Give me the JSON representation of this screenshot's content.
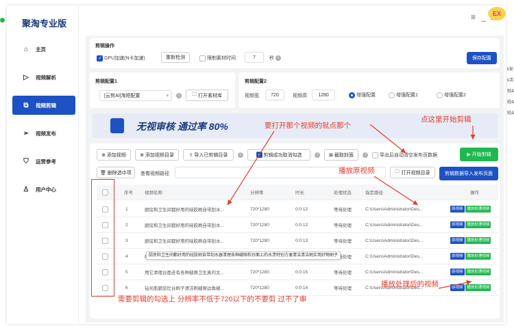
{
  "brand": "聚淘专业版",
  "window": {
    "badge": "EX"
  },
  "nav": [
    {
      "label": "主页",
      "icon": "home-icon",
      "active": false
    },
    {
      "label": "视频解析",
      "icon": "play-icon",
      "active": false
    },
    {
      "label": "视频剪辑",
      "icon": "edit-icon",
      "active": true
    },
    {
      "label": "视频发布",
      "icon": "send-icon",
      "active": false
    },
    {
      "label": "运营参考",
      "icon": "shield-icon",
      "active": false
    },
    {
      "label": "用户中心",
      "icon": "user-icon",
      "active": false
    }
  ],
  "ops": {
    "title": "剪辑操作",
    "gpu_label": "GPU加速(N卡加速)",
    "recheck": "重新检测",
    "limit_label": "限制素材时间",
    "limit_value": "7",
    "limit_unit": "秒",
    "save_config": "保存配置"
  },
  "config1": {
    "title": "剪辑配置1",
    "select_value": "[云剪AI]淘短配置",
    "open_lib": "打开素材库"
  },
  "config2": {
    "title": "剪辑配置2",
    "width_label": "视频宽",
    "width_value": "720",
    "height_label": "视频高",
    "height_value": "1280",
    "radios": [
      "增强配置",
      "增强配置1",
      "增强配置2"
    ]
  },
  "banner": {
    "text": "无视审核 通过率 80%"
  },
  "toolbar": {
    "add_video": "添加视频",
    "add_dir": "添加视频目录",
    "import": "导入已剪辑目录",
    "cut_done": "剪辑成功取消勾选",
    "screenshot": "截取封面",
    "auto_clear": "导出后自动清空发布页数据",
    "start": "开始剪辑",
    "delete_selected": "删除选中项",
    "view_path": "查看视频路径",
    "open_dir": "打开视频目录",
    "import_publish": "剪辑数据导入发布页面"
  },
  "table": {
    "headers": [
      "序号",
      "视频名称",
      "分辨率",
      "时长",
      "处理状态",
      "指定路径",
      "操作"
    ],
    "rows": [
      {
        "no": "1",
        "name": "厨房和卫生间都好用的硅胶刷自带刮水...",
        "res": "720*1280",
        "dur": "0:0:12",
        "status": "等待处理",
        "path": "C:\\Users\\Administrator\\Des..."
      },
      {
        "no": "2",
        "name": "厨房和卫生间都好用的硅胶刷自带刮水...",
        "res": "720*1280",
        "dur": "0:0:12",
        "status": "等待处理",
        "path": "C:\\Users\\Administrator\\Des..."
      },
      {
        "no": "3",
        "name": "厨房和卫生间都好用的硅胶刷自带刮水...",
        "res": "720*1280",
        "dur": "0:0:13",
        "status": "等待处理",
        "path": "C:\\Users\\Administrator\\Des..."
      },
      {
        "no": "4",
        "name": "硅胶刮板刷它最硅胶材质适用于厨房...",
        "res": "720*1280",
        "dur": "0:0:12",
        "status": "等待处理",
        "path": "C:\\Users\\Administrator\\Des..."
      },
      {
        "no": "5",
        "name": "用它清理台面还有各种缝隙卫生真的太...",
        "res": "720*1280",
        "dur": "0:0:15",
        "status": "等待处理",
        "path": "C:\\Users\\Administrator\\Des..."
      },
      {
        "no": "6",
        "name": "钻光肌厨房灶台刷子清洁刷缝隙边角缝...",
        "res": "720*1280",
        "dur": "0:0:14",
        "status": "等待处理",
        "path": "C:\\Users\\Administrator\\Des..."
      }
    ],
    "op_original": "原视频",
    "op_processed": "播放处理视频"
  },
  "tooltip": "厨房和卫生间都好用的硅胶刷自带刮水器清理各种缝隙和台面上的水渍特别方便清洁清洁刷实用好物刷子",
  "annotations": {
    "click_video": "要打开那个视频的就点那个",
    "start_here": "点这里开始剪辑",
    "play_original": "播放原视频",
    "play_processed": "播放处理后的视频",
    "check_note": "需要剪辑的勾选上  分辨率不低于720以下的不要剪  过不了审"
  },
  "right_edge": [
    "k安",
    "k活",
    "轻&",
    "轻&",
    "轻&"
  ],
  "colors": {
    "primary": "#1d51c4",
    "green": "#1fb84f",
    "annotation": "#e23b2a"
  }
}
